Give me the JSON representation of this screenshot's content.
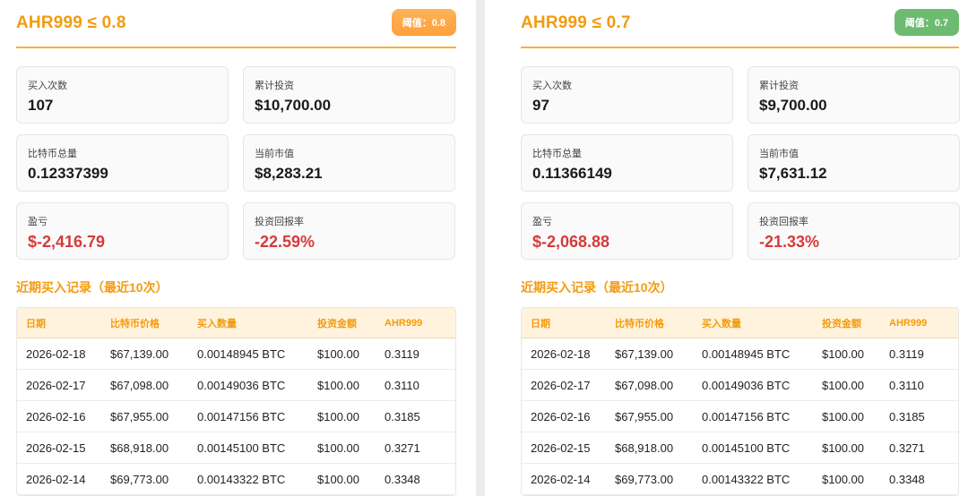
{
  "panels": [
    {
      "title": "AHR999 ≤ 0.8",
      "badge": "阈值：0.8",
      "badge_color": "#ff9f3a",
      "stats": {
        "buy_count_label": "买入次数",
        "buy_count_value": "107",
        "total_invest_label": "累计投资",
        "total_invest_value": "$10,700.00",
        "btc_total_label": "比特币总量",
        "btc_total_value": "0.12337399",
        "market_value_label": "当前市值",
        "market_value_value": "$8,283.21",
        "pnl_label": "盈亏",
        "pnl_value": "$-2,416.79",
        "roi_label": "投资回报率",
        "roi_value": "-22.59%"
      },
      "section_title": "近期买入记录（最近10次）",
      "headers": [
        "日期",
        "比特币价格",
        "买入数量",
        "投资金额",
        "AHR999"
      ],
      "rows": [
        [
          "2026-02-18",
          "$67,139.00",
          "0.00148945 BTC",
          "$100.00",
          "0.3119"
        ],
        [
          "2026-02-17",
          "$67,098.00",
          "0.00149036 BTC",
          "$100.00",
          "0.3110"
        ],
        [
          "2026-02-16",
          "$67,955.00",
          "0.00147156 BTC",
          "$100.00",
          "0.3185"
        ],
        [
          "2026-02-15",
          "$68,918.00",
          "0.00145100 BTC",
          "$100.00",
          "0.3271"
        ],
        [
          "2026-02-14",
          "$69,773.00",
          "0.00143322 BTC",
          "$100.00",
          "0.3348"
        ]
      ]
    },
    {
      "title": "AHR999 ≤ 0.7",
      "badge": "阈值：0.7",
      "badge_color": "#6dbb71",
      "stats": {
        "buy_count_label": "买入次数",
        "buy_count_value": "97",
        "total_invest_label": "累计投资",
        "total_invest_value": "$9,700.00",
        "btc_total_label": "比特币总量",
        "btc_total_value": "0.11366149",
        "market_value_label": "当前市值",
        "market_value_value": "$7,631.12",
        "pnl_label": "盈亏",
        "pnl_value": "$-2,068.88",
        "roi_label": "投资回报率",
        "roi_value": "-21.33%"
      },
      "section_title": "近期买入记录（最近10次）",
      "headers": [
        "日期",
        "比特币价格",
        "买入数量",
        "投资金额",
        "AHR999"
      ],
      "rows": [
        [
          "2026-02-18",
          "$67,139.00",
          "0.00148945 BTC",
          "$100.00",
          "0.3119"
        ],
        [
          "2026-02-17",
          "$67,098.00",
          "0.00149036 BTC",
          "$100.00",
          "0.3110"
        ],
        [
          "2026-02-16",
          "$67,955.00",
          "0.00147156 BTC",
          "$100.00",
          "0.3185"
        ],
        [
          "2026-02-15",
          "$68,918.00",
          "0.00145100 BTC",
          "$100.00",
          "0.3271"
        ],
        [
          "2026-02-14",
          "$69,773.00",
          "0.00143322 BTC",
          "$100.00",
          "0.3348"
        ]
      ]
    }
  ]
}
